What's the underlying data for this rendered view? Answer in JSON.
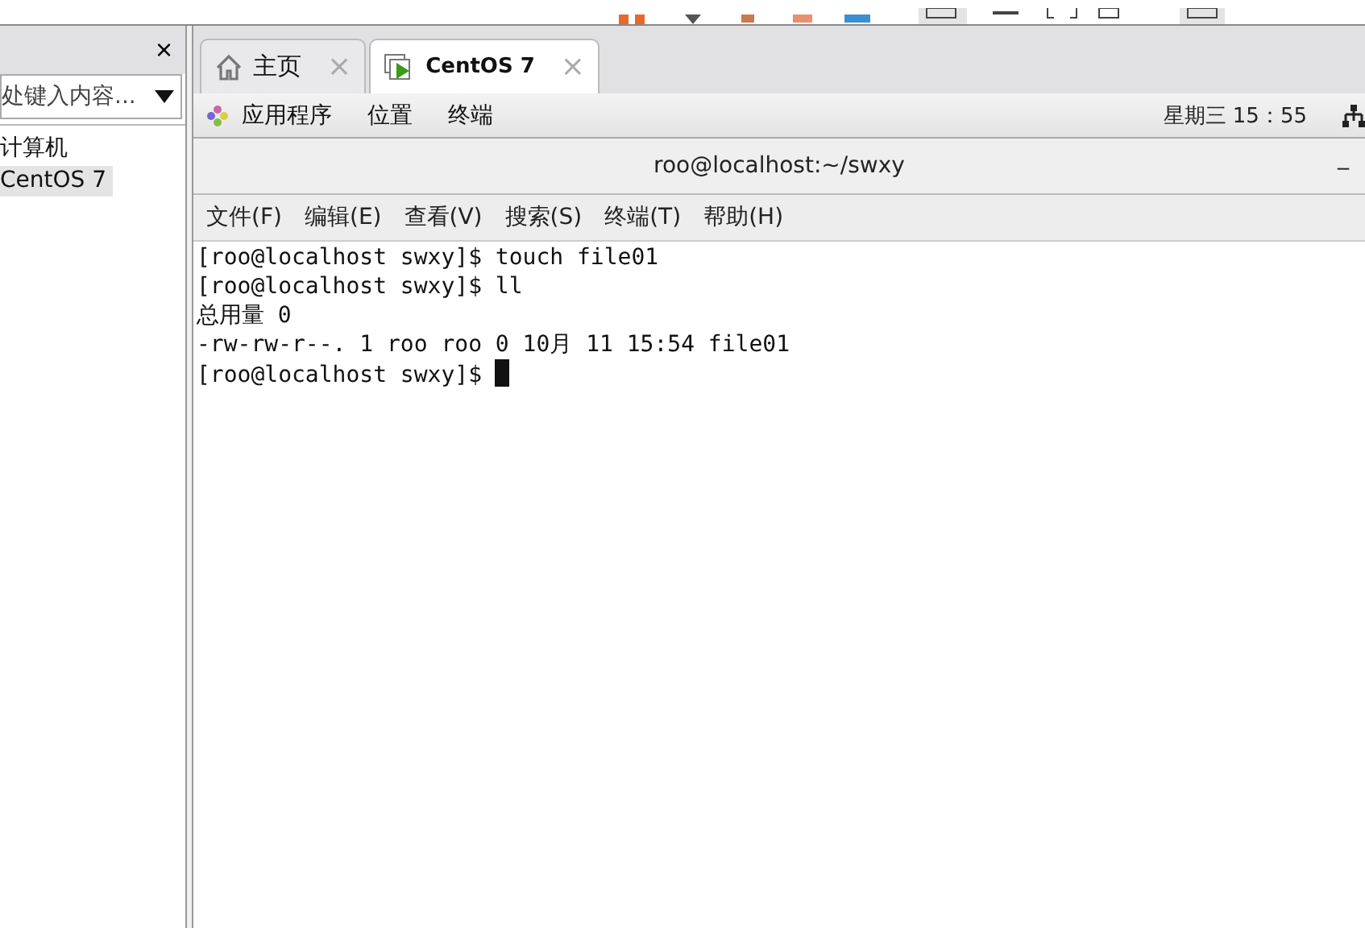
{
  "library": {
    "close": "×",
    "search": {
      "placeholder": "处键入内容..."
    },
    "items": [
      {
        "label": "计算机",
        "selected": false
      },
      {
        "label": "CentOS 7",
        "selected": true
      }
    ]
  },
  "tabs": [
    {
      "label": "主页",
      "kind": "home",
      "selected": false,
      "close": "×"
    },
    {
      "label": "CentOS 7",
      "kind": "vm",
      "selected": true,
      "close": "×"
    }
  ],
  "top_bar": {
    "menus": [
      "应用程序",
      "位置",
      "终端"
    ],
    "clock": "星期三 15：55"
  },
  "terminal": {
    "title": "roo@localhost:~/swxy",
    "minimize": "_",
    "menu": [
      "文件(F)",
      "编辑(E)",
      "查看(V)",
      "搜索(S)",
      "终端(T)",
      "帮助(H)"
    ],
    "lines": [
      "[roo@localhost swxy]$ touch file01",
      "[roo@localhost swxy]$ ll",
      "总用量 0",
      "-rw-rw-r--. 1 roo roo 0 10月 11 15:54 file01",
      "[roo@localhost swxy]$ "
    ]
  }
}
